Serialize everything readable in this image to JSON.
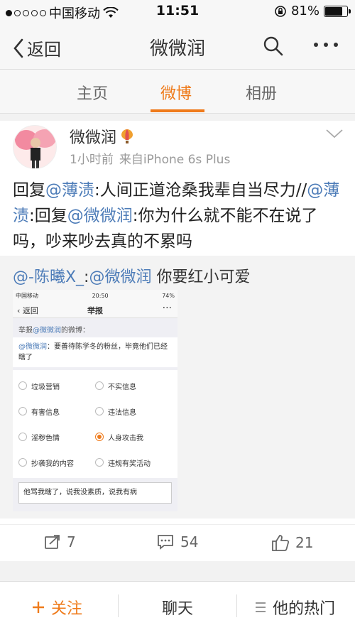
{
  "status": {
    "carrier": "中国移动",
    "time": "11:51",
    "battery": "81%",
    "battery_level": 0.81
  },
  "nav": {
    "back_label": "返回",
    "title": "微微润"
  },
  "tabs": [
    {
      "label": "主页"
    },
    {
      "label": "微博"
    },
    {
      "label": "相册"
    }
  ],
  "post": {
    "username": "微微润",
    "time": "1小时前",
    "source": "来自iPhone 6s Plus",
    "text": {
      "p1": "回复",
      "at1": "@薄渍",
      "p2": ":人间正道沧桑我辈自当尽力//",
      "at2": "@薄渍",
      "p3": ":回复",
      "at3": "@微微润",
      "p4": ":你为什么就不能不在说了吗，吵来吵去真的不累吗"
    },
    "retweet": {
      "at1": "@-陈曦X_",
      "p1": ":",
      "at2": "@微微润",
      "p2": " 你要红小可爱"
    }
  },
  "embedded": {
    "status_carrier": "中国移动",
    "status_time": "20:50",
    "status_battery": "74%",
    "back": "返回",
    "title": "举报",
    "label_prefix": "举报",
    "label_at": "@微微润",
    "label_suffix": "的微博：",
    "quote_at": "@微微润",
    "quote_text": "：要善待陈学冬的粉丝，毕竟他们已经瞎了",
    "options": [
      [
        "垃圾营销",
        "不实信息"
      ],
      [
        "有害信息",
        "违法信息"
      ],
      [
        "淫秽色情",
        "人身攻击我"
      ],
      [
        "抄袭我的内容",
        "违规有奖活动"
      ]
    ],
    "selected": "人身攻击我",
    "textarea": "他骂我瞎了，说我没素质，说我有病"
  },
  "actions": {
    "repost": "7",
    "comment": "54",
    "like": "21"
  },
  "bottom": {
    "follow": "关注",
    "chat": "聊天",
    "hot": "他的热门"
  },
  "colors": {
    "accent": "#ef7b1b",
    "link": "#4d7cb8"
  }
}
